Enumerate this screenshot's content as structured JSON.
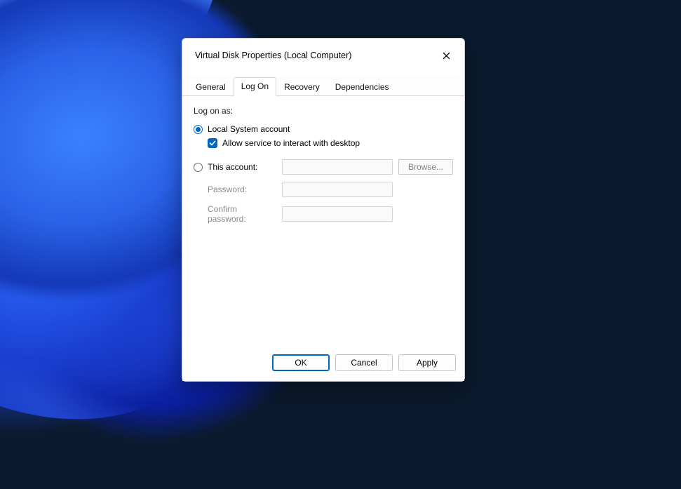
{
  "window": {
    "title": "Virtual Disk Properties (Local Computer)"
  },
  "tabs": {
    "general": "General",
    "logon": "Log On",
    "recovery": "Recovery",
    "dependencies": "Dependencies",
    "active": "logon"
  },
  "logon": {
    "section_label": "Log on as:",
    "local_system_label": "Local System account",
    "local_system_selected": true,
    "interact_label": "Allow service to interact with desktop",
    "interact_checked": true,
    "this_account_label": "This account:",
    "this_account_selected": false,
    "this_account_value": "",
    "browse_label": "Browse...",
    "password_label": "Password:",
    "password_value": "",
    "confirm_label": "Confirm password:",
    "confirm_value": ""
  },
  "buttons": {
    "ok": "OK",
    "cancel": "Cancel",
    "apply": "Apply"
  }
}
